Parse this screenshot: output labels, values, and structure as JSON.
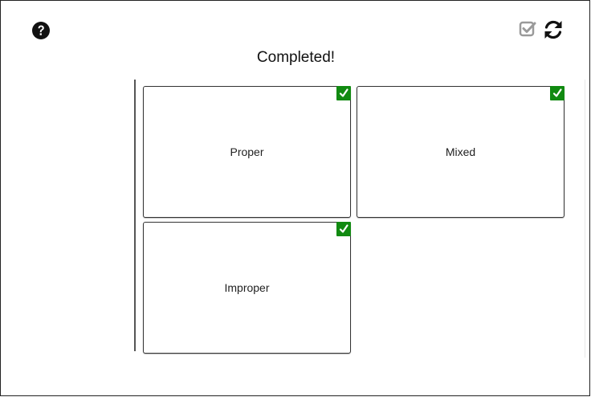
{
  "status_text": "Completed!",
  "icons": {
    "help": "question-circle-icon",
    "check": "checkbox-checked-icon",
    "reset": "refresh-icon"
  },
  "colors": {
    "badge": "#118a11",
    "check_icon": "#9a9a9a",
    "help_icon": "#111111"
  },
  "cards": [
    {
      "label": "Proper",
      "checked": true
    },
    {
      "label": "Mixed",
      "checked": true
    },
    {
      "label": "Improper",
      "checked": true
    }
  ]
}
